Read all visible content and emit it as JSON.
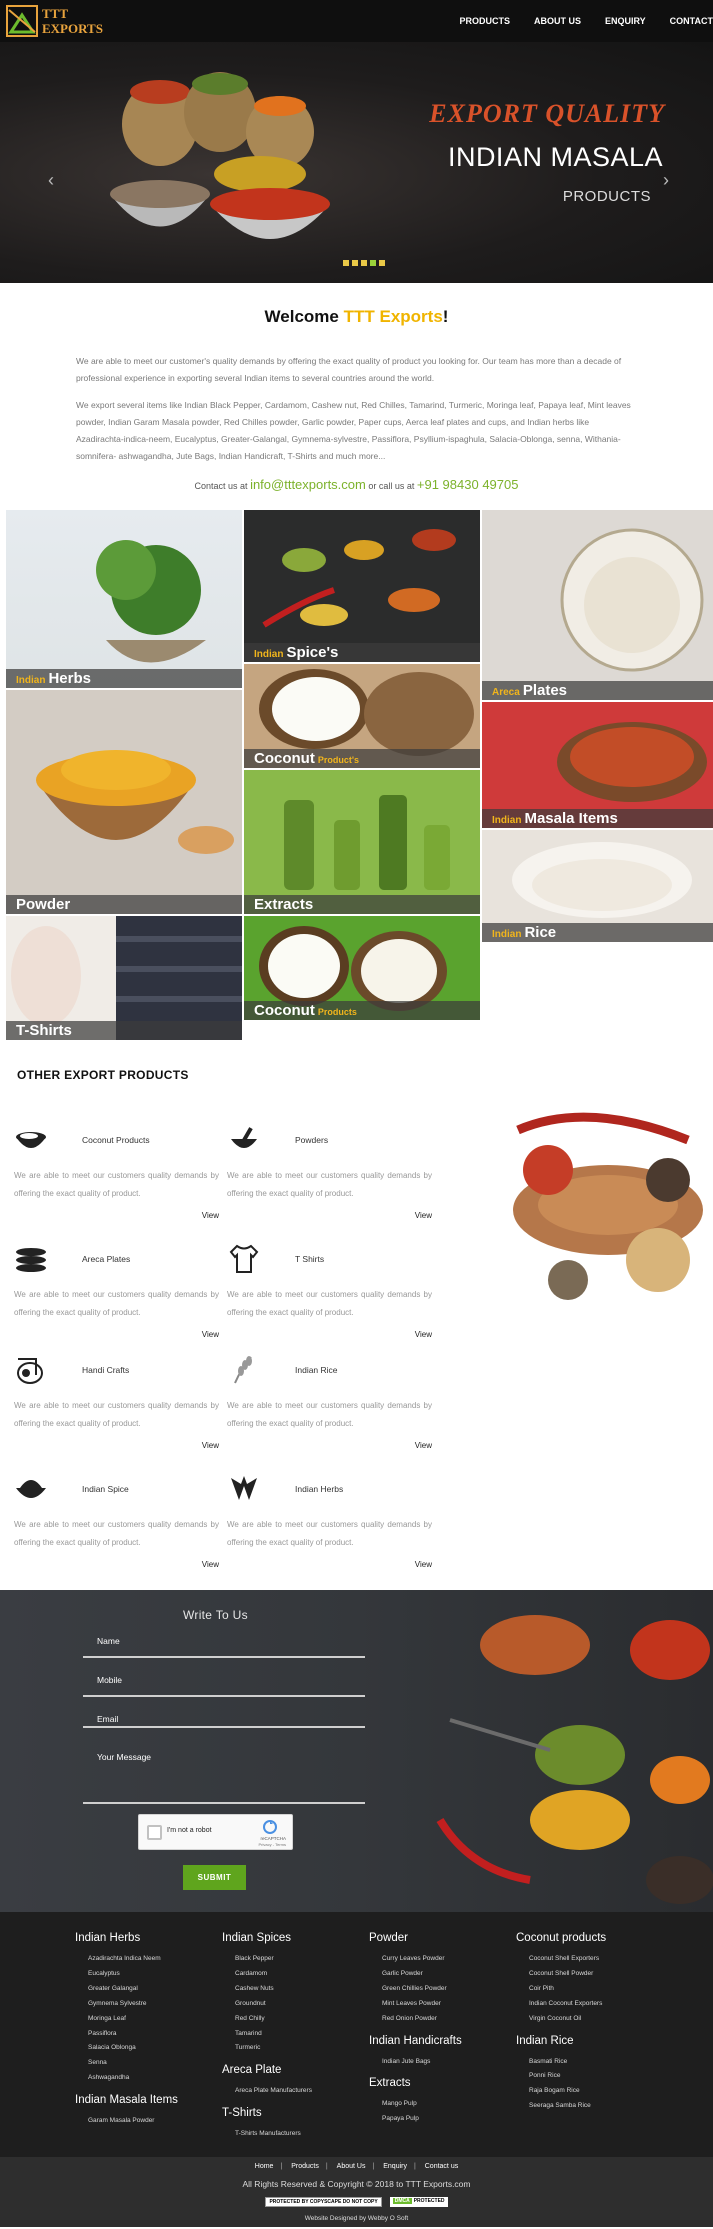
{
  "nav": {
    "logo_line1": "TTT",
    "logo_line2": "EXPORTS",
    "items": [
      "PRODUCTS",
      "ABOUT US",
      "ENQUIRY",
      "CONTACT"
    ]
  },
  "hero": {
    "title_accent": "EXPORT QUALITY",
    "title_main": "INDIAN MASALA",
    "title_sub": "PRODUCTS",
    "prev_icon": "‹",
    "next_icon": "›",
    "slides": 5,
    "active_slide": 4
  },
  "welcome": {
    "title_pre": "Welcome ",
    "title_brand": "TTT Exports",
    "title_post": "!",
    "para1": "We are able to meet our customer's quality demands by offering the exact quality of product you looking for. Our team has more than a decade of professional experience in exporting several Indian items to several countries around the world.",
    "para2": "We export several items like Indian Black Pepper, Cardamom, Cashew nut, Red Chilles, Tamarind, Turmeric, Moringa leaf, Papaya leaf, Mint leaves powder, Indian Garam Masala powder, Red Chilles powder, Garlic powder, Paper cups, Aerca leaf plates and cups, and Indian herbs like Azadirachta-indica-neem, Eucalyptus, Greater-Galangal, Gymnema-sylvestre, Passiflora, Psyllium-ispaghula, Salacia-Oblonga, senna, Withania-somnifera- ashwagandha, Jute Bags, Indian Handicraft, T-Shirts and much more...",
    "contact_pre": "Contact us at ",
    "email": "info@tttexports.com",
    "contact_mid": " or call us at ",
    "phone": "+91 98430 49705"
  },
  "tiles": [
    {
      "pre": "Indian",
      "label": "Herbs",
      "post": ""
    },
    {
      "pre": "Indian",
      "label": "Spice's",
      "post": ""
    },
    {
      "pre": "Areca",
      "label": "Plates",
      "post": ""
    },
    {
      "pre": "",
      "label": "Coconut",
      "post": "Product's"
    },
    {
      "pre": "",
      "label": "Powder",
      "post": ""
    },
    {
      "pre": "Indian",
      "label": "Masala Items",
      "post": ""
    },
    {
      "pre": "",
      "label": "Extracts",
      "post": ""
    },
    {
      "pre": "Indian",
      "label": "Rice",
      "post": ""
    },
    {
      "pre": "",
      "label": "Coconut",
      "post": "Products"
    },
    {
      "pre": "",
      "label": "T-Shirts",
      "post": ""
    }
  ],
  "other": {
    "heading": "OTHER EXPORT PRODUCTS",
    "desc": "We are able to meet our customers quality demands by offering the exact quality of product.",
    "view": "View",
    "products": [
      {
        "name": "Coconut Products",
        "icon": "coconut-icon"
      },
      {
        "name": "Powders",
        "icon": "mortar-icon"
      },
      {
        "name": "Areca Plates",
        "icon": "plates-icon"
      },
      {
        "name": "T Shirts",
        "icon": "tshirt-icon"
      },
      {
        "name": "Handi Crafts",
        "icon": "handicraft-icon"
      },
      {
        "name": "Indian Rice",
        "icon": "rice-icon"
      },
      {
        "name": "Indian Spice",
        "icon": "spice-bowl-icon"
      },
      {
        "name": "Indian Herbs",
        "icon": "herb-leaf-icon"
      }
    ]
  },
  "form": {
    "heading": "Write To Us",
    "name": "Name",
    "mobile": "Mobile",
    "email": "Email",
    "message": "Your Message",
    "captcha_label": "I'm not a robot",
    "captcha_brand": "reCAPTCHA",
    "captcha_terms": "Privacy - Terms",
    "submit": "SUBMIT"
  },
  "footer": {
    "herbs": {
      "title": "Indian Herbs",
      "items": [
        "Azadirachta Indica Neem",
        "Eucalyptus",
        "Greater Galangal",
        "Gymnema Sylvestre",
        "Moringa Leaf",
        "Passiflora",
        "Salacia Oblonga",
        "Senna",
        "Ashwagandha"
      ]
    },
    "masala": {
      "title": "Indian Masala Items",
      "items": [
        "Garam Masala Powder"
      ]
    },
    "spices": {
      "title": "Indian Spices",
      "items": [
        "Black Pepper",
        "Cardamom",
        "Cashew Nuts",
        "Groundnut",
        "Red Chilly",
        "Tamarind",
        "Turmeric"
      ]
    },
    "areca": {
      "title": "Areca Plate",
      "items": [
        "Areca Plate Manufacturers"
      ]
    },
    "tshirts": {
      "title": "T-Shirts",
      "items": [
        "T-Shirts Manufacturers"
      ]
    },
    "powder": {
      "title": "Powder",
      "items": [
        "Curry Leaves Powder",
        "Garlic Powder",
        "Green Chillies Powder",
        "Mint Leaves Powder",
        "Red Onion Powder"
      ]
    },
    "handicrafts": {
      "title": "Indian Handicrafts",
      "items": [
        "Indian Jute Bags"
      ]
    },
    "extracts": {
      "title": "Extracts",
      "items": [
        "Mango Pulp",
        "Papaya Pulp"
      ]
    },
    "coconut": {
      "title": "Coconut products",
      "items": [
        "Coconut Shell Exporters",
        "Coconut Shell Powder",
        "Coir Pith",
        "Indian Coconut Exporters",
        "Virgin Coconut Oil"
      ]
    },
    "rice": {
      "title": "Indian Rice",
      "items": [
        "Basmati Rice",
        "Ponni Rice",
        "Raja Bogam Rice",
        "Seeraga Samba Rice"
      ]
    }
  },
  "bottom": {
    "links": [
      "Home",
      "Products",
      "About Us",
      "Enquiry",
      "Contact us"
    ],
    "copyright": "All Rights Reserved & Copyright © 2018 to TTT Exports.com",
    "badge1": "PROTECTED BY COPYSCAPE DO NOT COPY",
    "badge2_a": "DMCA",
    "badge2_b": "PROTECTED",
    "webby": "Website Designed by Webby O Soft"
  },
  "colors": {
    "accent_green": "#7cb22b",
    "brand_yellow": "#f0b400",
    "hero_orange": "#d9522a",
    "submit_green": "#5fa51d"
  }
}
